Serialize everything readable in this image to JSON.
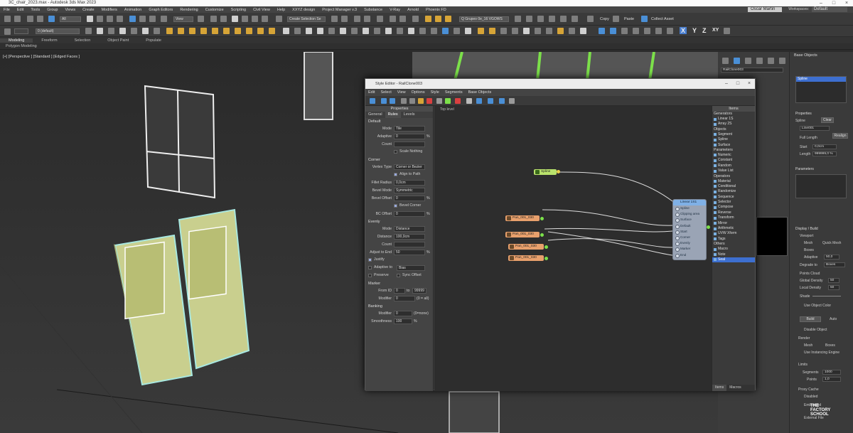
{
  "titlebar": {
    "title": "3C_chair_2023.max - Autodesk 3ds Max 2023"
  },
  "menu": {
    "items": [
      "File",
      "Edit",
      "Tools",
      "Group",
      "Views",
      "Create",
      "Modifiers",
      "Animation",
      "Graph Editors",
      "Rendering",
      "Customize",
      "Scripting",
      "Civil View",
      "Help",
      "XXYZ design",
      "Project Manager v.3",
      "Substance",
      "V-Ray",
      "Arnold",
      "Phoenix FD"
    ],
    "user": "Oscar Martin",
    "workspaces_label": "Workspaces:",
    "workspace": "Default"
  },
  "toolbar": {
    "filter_dropdown": "All",
    "view_dropdown": "View",
    "selection_set": "Create Selection Se",
    "layer_dropdown": "0 (default)",
    "named_dropdown": "Q Grupeo 0e_16 VGOWS",
    "copy": "Copy",
    "paste": "Paste",
    "collect_asset": "Collect Asset",
    "axes": [
      "X",
      "Y",
      "Z",
      "XY"
    ]
  },
  "ribbon": {
    "tabs": [
      "Modeling",
      "Freeform",
      "Selection",
      "Object Paint",
      "Populate"
    ],
    "active": "Modeling",
    "subtitle": "Polygon Modeling"
  },
  "viewport": {
    "label": "[+] [Perspective ] [Standard ] [Edged Faces ]"
  },
  "editor": {
    "title": "Style Editor - RailClone003",
    "menu": [
      "Edit",
      "Select",
      "View",
      "Options",
      "Style",
      "Segments",
      "Base Objects"
    ],
    "properties": {
      "header": "Properties",
      "tabs": [
        "General",
        "Rules",
        "Levels"
      ],
      "active_tab": "Rules",
      "default_section": "Default",
      "mode_label": "Mode",
      "mode_value": "Tile",
      "adaptive_label": "Adaptive",
      "adaptive_value": "0",
      "adaptive_unit": "%",
      "count_label": "Count",
      "scale_nothing": "Scale Nothing",
      "corner_section": "Corner",
      "vertex_type_label": "Vertex Type",
      "vertex_type_value": "Corner or Bezier",
      "align_path": "Align to Path",
      "fillet_label": "Fillet Radius",
      "fillet_value": "0,0cm",
      "bevel_mode_label": "Bevel Mode",
      "bevel_mode_value": "Symmetric",
      "bevel_offset_label": "Bevel Offset",
      "bevel_offset_value": "0",
      "bevel_offset_unit": "%",
      "bevel_corner": "Bevel Corner",
      "bc_offset_label": "BC Offset",
      "bc_offset_value": "0",
      "bc_offset_unit": "%",
      "evenly_section": "Evenly",
      "evenly_mode_label": "Mode",
      "evenly_mode_value": "Distance",
      "distance_label": "Distance",
      "distance_value": "100,0cm",
      "evenly_count_label": "Count",
      "adjust_label": "Adjust to End",
      "adjust_value": "50",
      "adjust_unit": "%",
      "justify": "Justify",
      "adaptive_to": "Adaptive to",
      "adaptive_to_value": "Bias",
      "preserve": "Preserve",
      "sync_offset": "Sync Offset",
      "marker_section": "Marker",
      "from_id_label": "From ID",
      "from_id_value": "0",
      "to_label": "to",
      "to_value": "99999",
      "modifier_label": "Modifier",
      "modifier_value": "0",
      "modifier_unit": "(0 = all)",
      "banking_section": "Banking",
      "banking_modifier_label": "Modifier",
      "banking_modifier_value": "0",
      "banking_modifier_unit": "(0=none)",
      "smoothness_label": "Smoothness",
      "smoothness_value": "100",
      "smoothness_unit": "%"
    },
    "canvas": {
      "label": "Top level",
      "spline_node": "Spline",
      "nodes": [
        "Pan_001_030",
        "Pan_001_030",
        "Pan_001_030",
        "Pan_001_030"
      ],
      "generator": {
        "title": "Linear 1S1",
        "ports": [
          "Spline",
          "Clipping area",
          "Surface",
          "Default",
          "Start",
          "Corner",
          "Evenly",
          "Marker",
          "End"
        ]
      }
    },
    "items": {
      "header": "Items",
      "categories": [
        {
          "name": "Generators",
          "items": [
            "Linear 1S",
            "Array 2S"
          ]
        },
        {
          "name": "Objects",
          "items": [
            "Segment",
            "Spline",
            "Surface"
          ]
        },
        {
          "name": "Parameters",
          "items": [
            "Numeric",
            "Constant",
            "Random",
            "Value List"
          ]
        },
        {
          "name": "Operators",
          "items": [
            "Material",
            "Conditional",
            "Randomize",
            "Sequence",
            "Selector",
            "Compose",
            "Reverse",
            "Transform",
            "Mirror",
            "Arithmetic",
            "UVW Xform",
            "Tags"
          ]
        },
        {
          "name": "Others",
          "items": [
            "Macro",
            "Note",
            "Seal"
          ]
        }
      ],
      "selected": "Seal",
      "bottom_tabs": [
        "Items",
        "Macros"
      ]
    }
  },
  "right_panel": {
    "object_name": "RailClone003",
    "base_objects_header": "Base Objects",
    "base_object": "Spline",
    "properties_header": "Properties",
    "spline_label": "Spline",
    "spline_btn": "Clear",
    "spline_value": "Line001",
    "full_length": "Full Length",
    "realign": "Realign",
    "start_label": "Start",
    "start_value": "0,0cm",
    "length_label": "Length",
    "length_value": "999999,0 %",
    "parameters_header": "Parameters",
    "display_header": "Display / Build",
    "viewport_label": "Viewport",
    "mesh": "Mesh",
    "quick_mesh": "Quick Mesh",
    "boxes": "Boxes",
    "adaptive_label": "Adaptive",
    "adaptive_value": "50,0",
    "degrade_label": "Degrade to",
    "degrade_value": "Boxes",
    "points_cloud": "Points Cloud",
    "global_density_label": "Global Density",
    "global_density_value": "50",
    "local_density_label": "Local Density",
    "local_density_value": "50",
    "shade_label": "Shade",
    "use_object_color": "Use Object Color",
    "build_btn": "Build",
    "auto_label": "Auto",
    "disable_object": "Disable Object",
    "render_label": "Render",
    "render_mesh": "Mesh",
    "render_boxes": "Boxes",
    "use_instancing": "Use Instancing Engine",
    "limits_label": "Limits",
    "segments_label": "Segments",
    "segments_value": "1000",
    "points_label": "Points",
    "points_value": "1,0",
    "proxy_label": "Proxy Cache",
    "disabled": "Disabled",
    "embedded": "Embedded",
    "external_file": "External File"
  },
  "logo": {
    "line1": "THE",
    "line2": "FACTORY",
    "line3": "SCHOOL"
  }
}
